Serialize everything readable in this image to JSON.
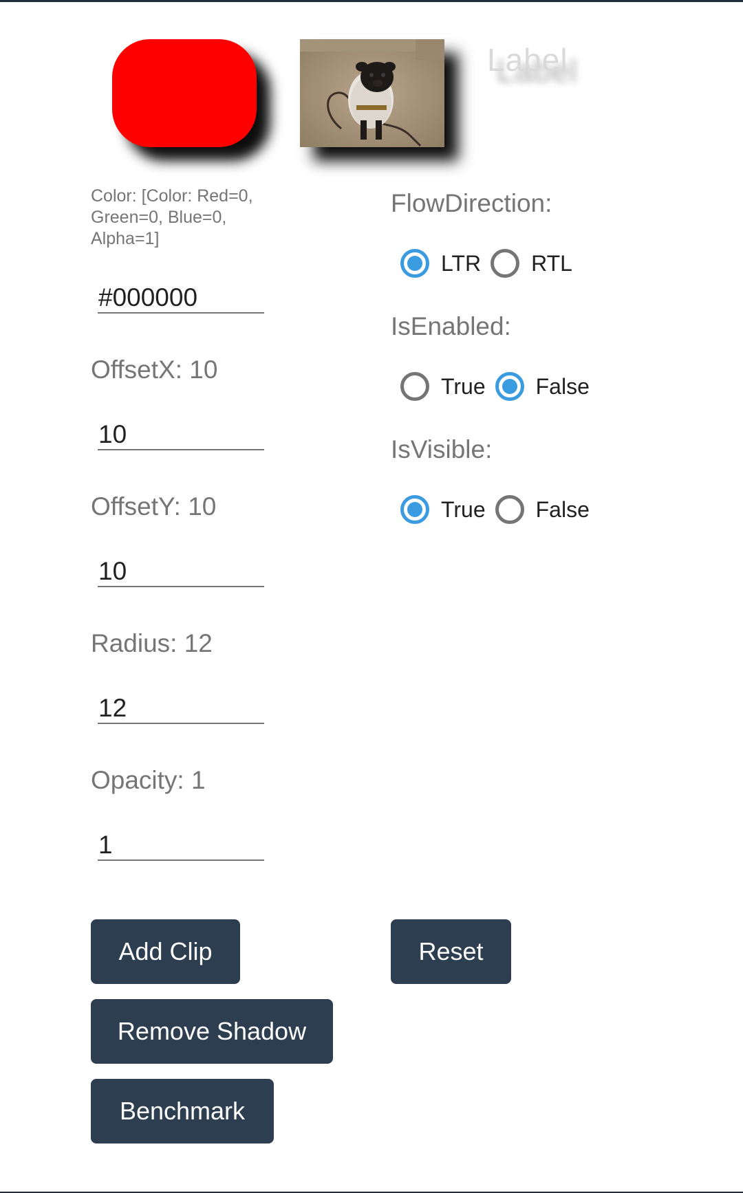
{
  "preview": {
    "label_text": "Label",
    "box_color": "#ff0000",
    "image_alt": "pug in a sweater"
  },
  "color_info": "Color: [Color: Red=0, Green=0, Blue=0, Alpha=1]",
  "fields": {
    "color_value": "#000000",
    "offset_x_label": "OffsetX: 10",
    "offset_x_value": "10",
    "offset_y_label": "OffsetY: 10",
    "offset_y_value": "10",
    "radius_label": "Radius: 12",
    "radius_value": "12",
    "opacity_label": "Opacity: 1",
    "opacity_value": "1"
  },
  "options": {
    "flow_direction": {
      "label": "FlowDirection:",
      "option1": "LTR",
      "option2": "RTL",
      "selected": "LTR"
    },
    "is_enabled": {
      "label": "IsEnabled:",
      "option1": "True",
      "option2": "False",
      "selected": "False"
    },
    "is_visible": {
      "label": "IsVisible:",
      "option1": "True",
      "option2": "False",
      "selected": "True"
    }
  },
  "buttons": {
    "add_clip": "Add Clip",
    "reset": "Reset",
    "remove_shadow": "Remove Shadow",
    "benchmark": "Benchmark"
  },
  "colors": {
    "accent": "#3b9be0",
    "button_bg": "#2c3e50",
    "label_gray": "#757575"
  }
}
